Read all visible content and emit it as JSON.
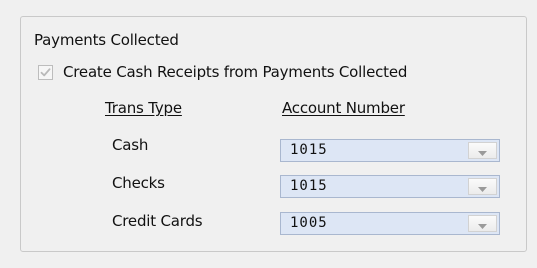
{
  "group": {
    "title": "Payments Collected"
  },
  "checkbox": {
    "label": "Create Cash Receipts from Payments Collected",
    "checked": true
  },
  "table": {
    "headers": {
      "trans_type": "Trans Type",
      "account_number": "Account Number"
    },
    "rows": [
      {
        "trans_type": "Cash",
        "account": "1015"
      },
      {
        "trans_type": "Checks",
        "account": "1015"
      },
      {
        "trans_type": "Credit Cards",
        "account": "1005"
      }
    ]
  },
  "colors": {
    "combo_background": "#dde6f5",
    "combo_border": "#a9b7cf",
    "checkmark_disabled": "#b9b9b9"
  },
  "icons": {
    "checkbox_mark": "check-icon",
    "dropdown_arrow": "chevron-down-icon"
  }
}
